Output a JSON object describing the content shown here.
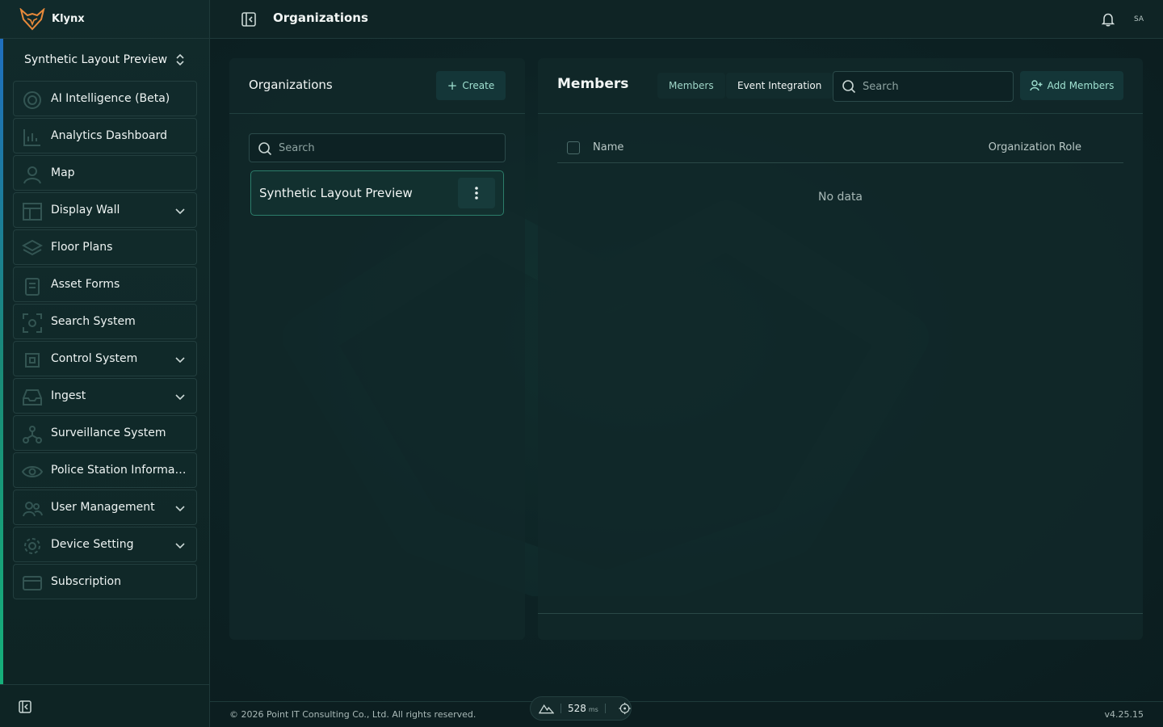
{
  "app": {
    "brand": "Klynx"
  },
  "sidebar": {
    "org_switch": "Synthetic Layout Preview",
    "items": [
      {
        "label": "AI Intelligence (Beta)",
        "icon": "ai-target-icon",
        "expandable": false
      },
      {
        "label": "Analytics Dashboard",
        "icon": "analytics-icon",
        "expandable": false
      },
      {
        "label": "Map",
        "icon": "user-pin-icon",
        "expandable": false
      },
      {
        "label": "Display Wall",
        "icon": "layout-icon",
        "expandable": true
      },
      {
        "label": "Floor Plans",
        "icon": "layers-icon",
        "expandable": false
      },
      {
        "label": "Asset Forms",
        "icon": "clipboard-icon",
        "expandable": false
      },
      {
        "label": "Search System",
        "icon": "scan-icon",
        "expandable": false
      },
      {
        "label": "Control System",
        "icon": "cpu-icon",
        "expandable": true
      },
      {
        "label": "Ingest",
        "icon": "inbox-icon",
        "expandable": true
      },
      {
        "label": "Surveillance System",
        "icon": "network-icon",
        "expandable": false
      },
      {
        "label": "Police Station Information",
        "icon": "eye-icon",
        "expandable": false
      },
      {
        "label": "User Management",
        "icon": "users-icon",
        "expandable": true
      },
      {
        "label": "Device Setting",
        "icon": "gear-icon",
        "expandable": true
      },
      {
        "label": "Subscription",
        "icon": "card-icon",
        "expandable": false
      }
    ]
  },
  "header": {
    "title": "Organizations",
    "avatar": "SA"
  },
  "orgs_panel": {
    "title": "Organizations",
    "create_label": "Create",
    "search_placeholder": "Search",
    "items": [
      {
        "name": "Synthetic Layout Preview"
      }
    ]
  },
  "members_panel": {
    "title": "Members",
    "tabs": [
      "Members",
      "Event Integration"
    ],
    "search_placeholder": "Search",
    "add_label": "Add Members",
    "columns": {
      "name": "Name",
      "role": "Organization Role"
    },
    "empty_text": "No data"
  },
  "footer": {
    "copyright": "© 2026 Point IT Consulting Co., Ltd. All rights reserved.",
    "version": "v4.25.15",
    "latency": "528",
    "latency_unit": "ms"
  },
  "colors": {
    "accent": "#9fe0d0",
    "background": "#0c1f21",
    "brand_orange": "#e98a3a"
  }
}
